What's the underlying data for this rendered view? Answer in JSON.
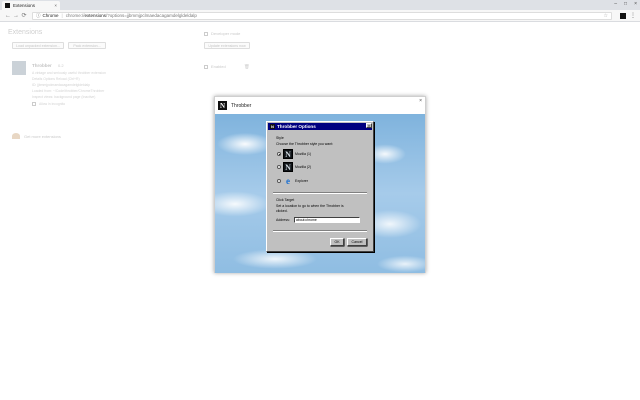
{
  "browser": {
    "tab_title": "Extensions",
    "tab_close": "×",
    "window_controls": [
      "–",
      "□",
      "×"
    ],
    "back": "←",
    "forward": "→",
    "reload": "⟳",
    "scheme_label": "Chrome",
    "url_prefix": "chrome://",
    "url_host": "extensions",
    "url_path": "/?options=jjbmmjpclmaedacagamdelgldeldalp",
    "star": "☆",
    "menu": "⋮"
  },
  "extensions_page": {
    "title": "Extensions",
    "developer_mode": "Developer mode",
    "load_unpacked": "Load unpacked extension...",
    "pack": "Pack extension...",
    "update": "Update extensions now",
    "ext_name": "Throbber",
    "ext_version": "0.2",
    "ext_description": "A vintage and seriously useful throbber extension",
    "ext_links": "Details     Options     Reload (Ctrl+R)",
    "ext_id": "ID: jjbmmjpclmaedacagamdelgldeldalp",
    "ext_loaded": "Loaded from: ~/Code/throbber/ChromeThrobber",
    "ext_inspect": "Inspect views: background page (Inactive)",
    "allow_incognito": "Allow in incognito",
    "enabled": "Enabled",
    "trash": "🗑",
    "get_more": "Get more extensions"
  },
  "throbber_window": {
    "title": "Throbber",
    "logo_letter": "N",
    "close": "×"
  },
  "dialog": {
    "title": "Throbber Options",
    "title_logo_letter": "N",
    "close": "×",
    "style_label": "Style",
    "style_prompt": "Choose the Throbber style you want:",
    "options": [
      {
        "label": "Mozilla (1)",
        "icon": "N",
        "selected": true
      },
      {
        "label": "Mozilla (2)",
        "icon": "N",
        "selected": false
      },
      {
        "label": "Explorer",
        "icon": "e",
        "selected": false
      }
    ],
    "click_target_label": "Click Target",
    "click_target_prompt_1": "Set a location to go to when the Throbber is",
    "click_target_prompt_2": "clicked.",
    "address_label": "Address:",
    "address_value": "about:chrome",
    "ok": "OK",
    "cancel": "Cancel"
  }
}
